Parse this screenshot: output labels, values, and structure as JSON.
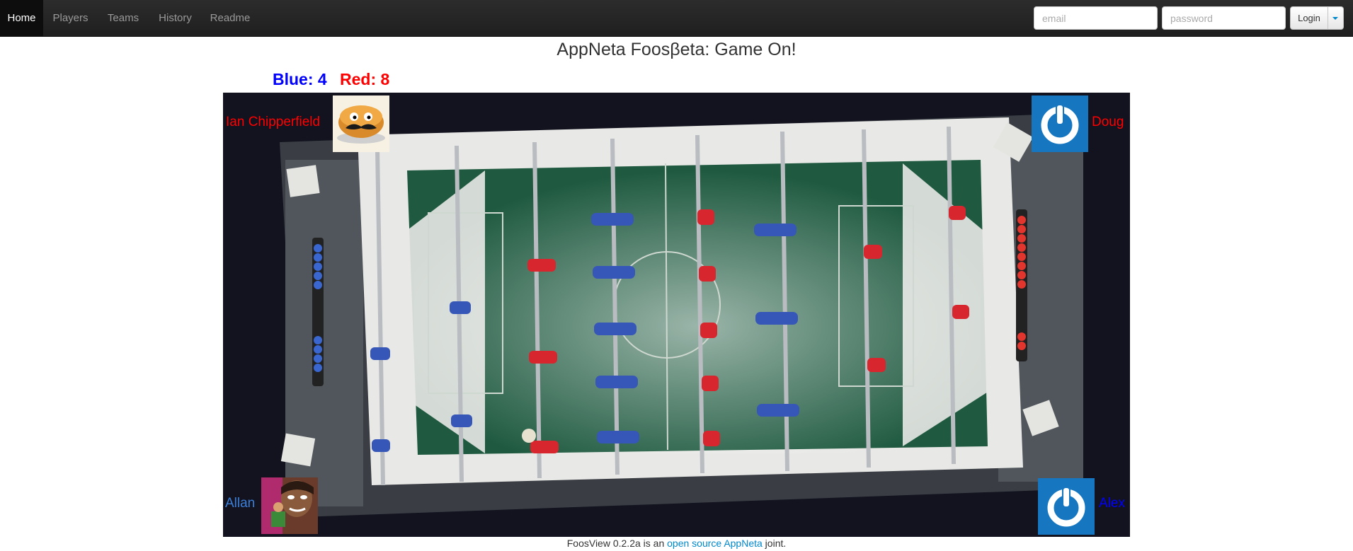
{
  "nav": {
    "items": [
      {
        "label": "Home",
        "active": true
      },
      {
        "label": "Players",
        "active": false
      },
      {
        "label": "Teams",
        "active": false
      },
      {
        "label": "History",
        "active": false
      },
      {
        "label": "Readme",
        "active": false
      }
    ],
    "email_placeholder": "email",
    "password_placeholder": "password",
    "login_label": "Login"
  },
  "title": "AppNeta Foosβeta: Game On!",
  "score": {
    "blue_label": "Blue: 4",
    "red_label": "Red: 8",
    "blue_color": "#0000ff",
    "red_color": "#ff0000"
  },
  "players": {
    "top_left": {
      "name": "Ian Chipperfield",
      "team_color": "#ff0000",
      "avatar_icon": "mustache-pancake-avatar"
    },
    "top_right": {
      "name": "Doug",
      "team_color": "#ff0000",
      "avatar_icon": "power-button-avatar"
    },
    "bottom_left": {
      "name": "Allan",
      "team_color": "#3b7fd9",
      "avatar_icon": "cartoon-character-avatar"
    },
    "bottom_right": {
      "name": "Alex",
      "team_color": "#0000ff",
      "avatar_icon": "power-button-avatar"
    }
  },
  "footer": {
    "prefix": "FoosView 0.2.2a is an ",
    "link1": "open source",
    "space": " ",
    "link2": "AppNeta",
    "suffix": " joint."
  }
}
